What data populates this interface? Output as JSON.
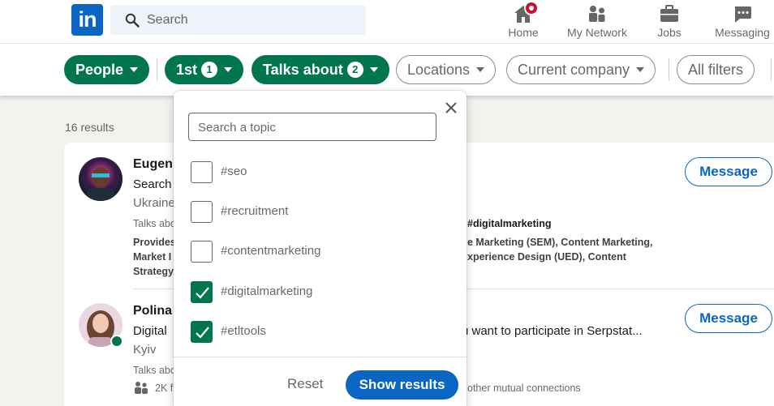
{
  "nav": {
    "search_placeholder": "Search",
    "items": [
      {
        "label": "Home",
        "icon": "home-icon"
      },
      {
        "label": "My Network",
        "icon": "network-icon"
      },
      {
        "label": "Jobs",
        "icon": "briefcase-icon"
      },
      {
        "label": "Messaging",
        "icon": "messaging-icon"
      }
    ]
  },
  "filters": {
    "people": "People",
    "first": "1st",
    "first_count": "1",
    "talks_about": "Talks about",
    "talks_about_count": "2",
    "locations": "Locations",
    "current_company": "Current company",
    "all_filters": "All filters"
  },
  "results": {
    "count": "16 results",
    "items": [
      {
        "name": "Eugen",
        "headline": "Search",
        "location": "Ukraine",
        "talks_prefix": "Talks abo",
        "talks_tag": "#digitalmarketing",
        "skills_1a": "Provides",
        "skills_1b": "e Marketing (SEM), Content Marketing,",
        "skills_2a": "Market I",
        "skills_2b": "xperience Design (UED), Content",
        "skills_3a": "Strategy",
        "message": "Message"
      },
      {
        "name": "Polina",
        "headline_a": "Digital",
        "headline_b": "u want to participate in Serpstat...",
        "location": "Kyiv",
        "talks_prefix": "Talks abo",
        "connections_a": "2K f",
        "connections_b": "other mutual connections",
        "message": "Message"
      }
    ]
  },
  "dropdown": {
    "search_placeholder": "Search a topic",
    "options": [
      {
        "label": "#seo",
        "checked": false
      },
      {
        "label": "#recruitment",
        "checked": false
      },
      {
        "label": "#contentmarketing",
        "checked": false
      },
      {
        "label": "#digitalmarketing",
        "checked": true
      },
      {
        "label": "#etltools",
        "checked": true
      }
    ],
    "reset": "Reset",
    "show_results": "Show results"
  },
  "colors": {
    "brand": "#0a66c2",
    "active_green": "#01754f",
    "notification": "#cb112d"
  }
}
